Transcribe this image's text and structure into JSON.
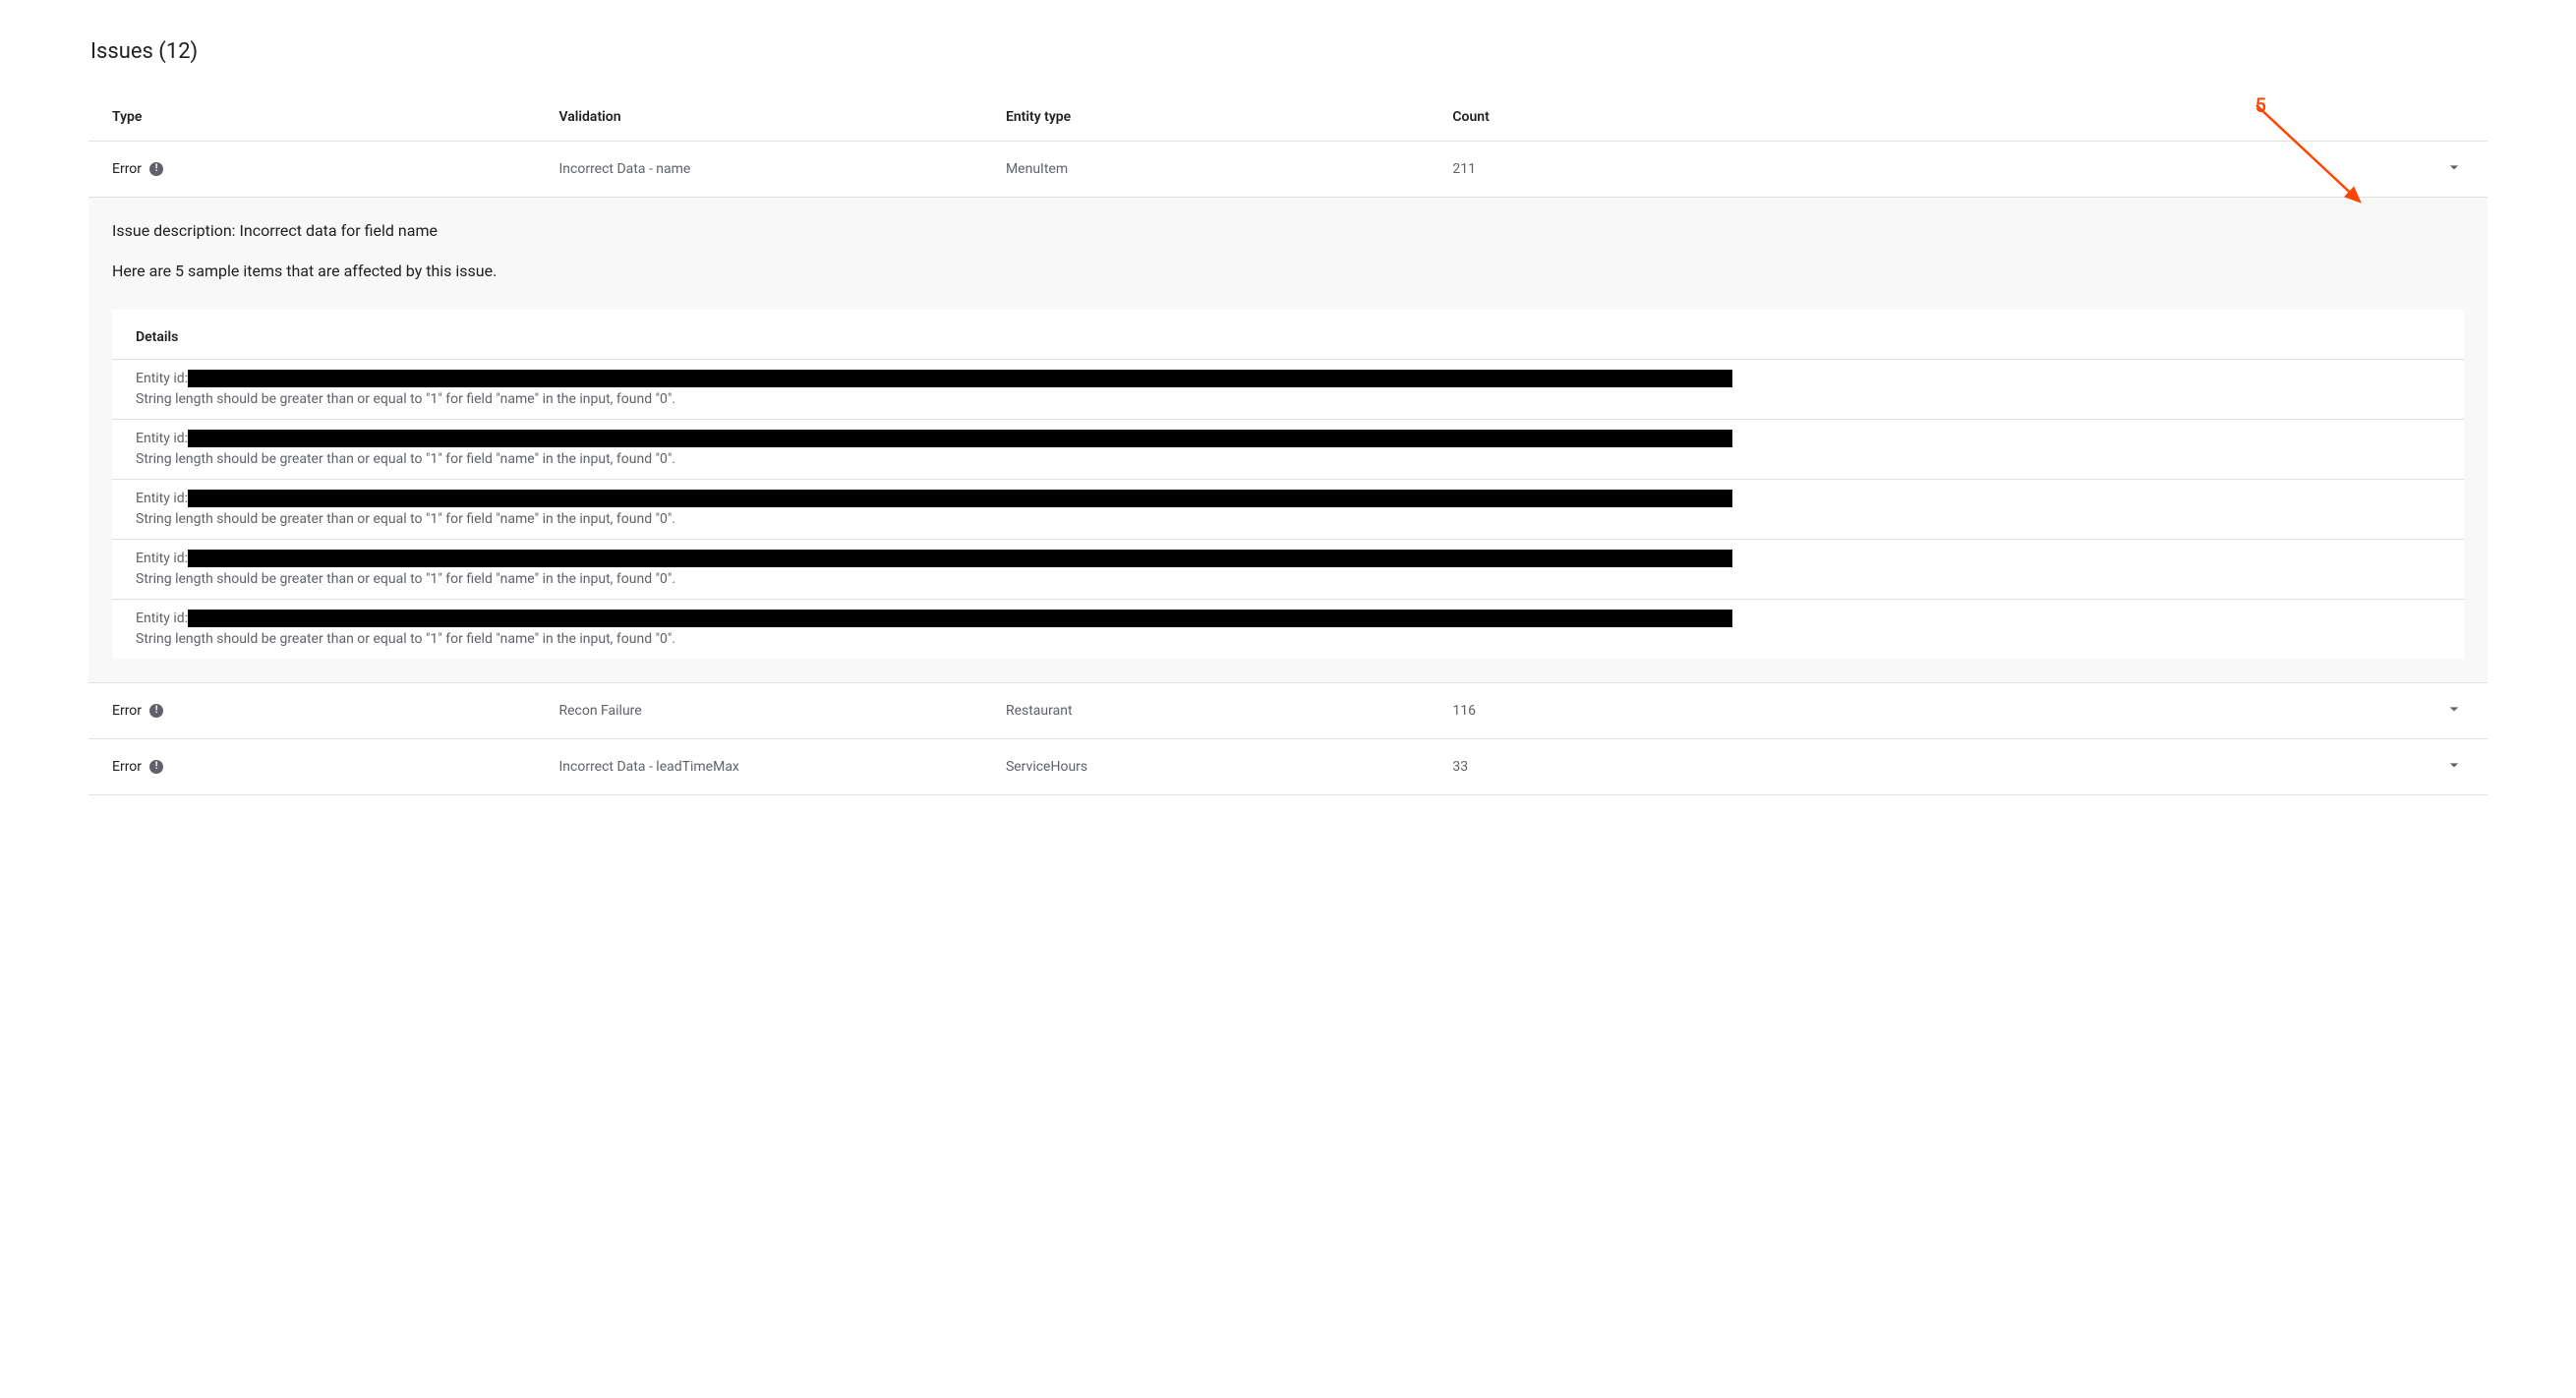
{
  "title": "Issues (12)",
  "columns": {
    "type": "Type",
    "validation": "Validation",
    "entity_type": "Entity type",
    "count": "Count"
  },
  "issues": [
    {
      "type": "Error",
      "validation": "Incorrect Data - name",
      "entity_type": "MenuItem",
      "count": "211",
      "expanded": true,
      "description": "Issue description: Incorrect data for field name",
      "sample_text": "Here are 5 sample items that are affected by this issue.",
      "details_title": "Details",
      "details": [
        {
          "entity_id_label": "Entity id:",
          "message": "String length should be greater than or equal to \"1\" for field \"name\" in the input, found \"0\"."
        },
        {
          "entity_id_label": "Entity id:",
          "message": "String length should be greater than or equal to \"1\" for field \"name\" in the input, found \"0\"."
        },
        {
          "entity_id_label": "Entity id:",
          "message": "String length should be greater than or equal to \"1\" for field \"name\" in the input, found \"0\"."
        },
        {
          "entity_id_label": "Entity id:",
          "message": "String length should be greater than or equal to \"1\" for field \"name\" in the input, found \"0\"."
        },
        {
          "entity_id_label": "Entity id:",
          "message": "String length should be greater than or equal to \"1\" for field \"name\" in the input, found \"0\"."
        }
      ]
    },
    {
      "type": "Error",
      "validation": "Recon Failure",
      "entity_type": "Restaurant",
      "count": "116",
      "expanded": false
    },
    {
      "type": "Error",
      "validation": "Incorrect Data - leadTimeMax",
      "entity_type": "ServiceHours",
      "count": "33",
      "expanded": false
    }
  ],
  "annotation": {
    "label": "5"
  }
}
